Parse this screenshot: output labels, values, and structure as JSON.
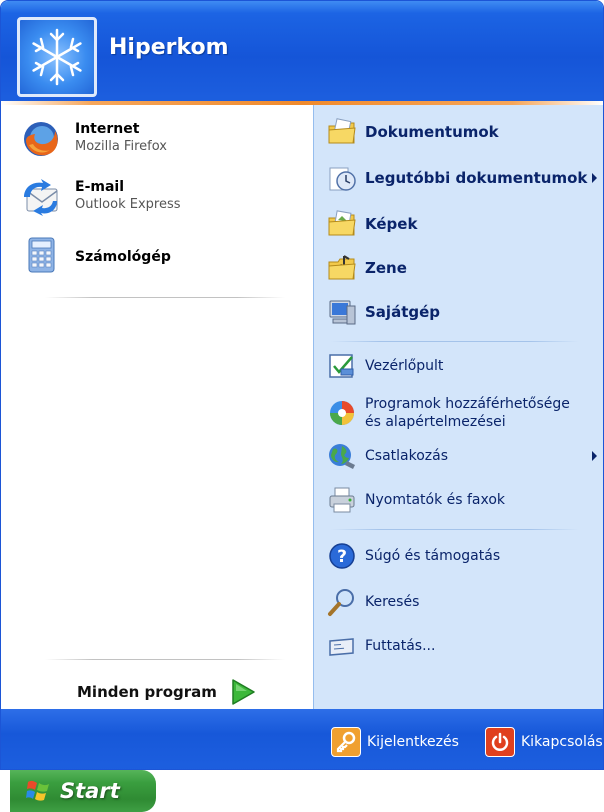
{
  "header": {
    "user_name": "Hiperkom"
  },
  "pinned": [
    {
      "title": "Internet",
      "subtitle": "Mozilla Firefox",
      "icon": "firefox-icon"
    },
    {
      "title": "E-mail",
      "subtitle": "Outlook Express",
      "icon": "outlook-express-icon"
    },
    {
      "title": "Számológép",
      "icon": "calculator-icon"
    }
  ],
  "all_programs": {
    "label": "Minden program",
    "icon": "green-arrow-icon"
  },
  "right_items": [
    {
      "label": "Dokumentumok",
      "icon": "documents-folder-icon"
    },
    {
      "label": "Legutóbbi dokumentumok",
      "icon": "recent-documents-icon",
      "submenu": true
    },
    {
      "label": "Képek",
      "icon": "pictures-folder-icon"
    },
    {
      "label": "Zene",
      "icon": "music-folder-icon"
    },
    {
      "label": "Sajátgép",
      "icon": "my-computer-icon"
    },
    {
      "label": "Vezérlőpult",
      "icon": "control-panel-icon"
    },
    {
      "label_line1": "Programok hozzáférhetősége",
      "label_line2": "és alapértelmezései",
      "icon": "program-defaults-icon"
    },
    {
      "label": "Csatlakozás",
      "icon": "connect-icon",
      "submenu": true
    },
    {
      "label": "Nyomtatók és faxok",
      "icon": "printer-icon"
    },
    {
      "label": "Súgó és támogatás",
      "icon": "help-icon"
    },
    {
      "label": "Keresés",
      "icon": "search-icon"
    },
    {
      "label": "Futtatás...",
      "icon": "run-icon"
    }
  ],
  "footer": {
    "logoff_label": "Kijelentkezés",
    "shutdown_label": "Kikapcsolás"
  },
  "taskbar": {
    "start_label": "Start"
  },
  "colors": {
    "header_blue": "#1555d8",
    "right_pane": "#d3e5fa",
    "start_green": "#3a9e3f",
    "accent_orange": "#f08a2c"
  }
}
